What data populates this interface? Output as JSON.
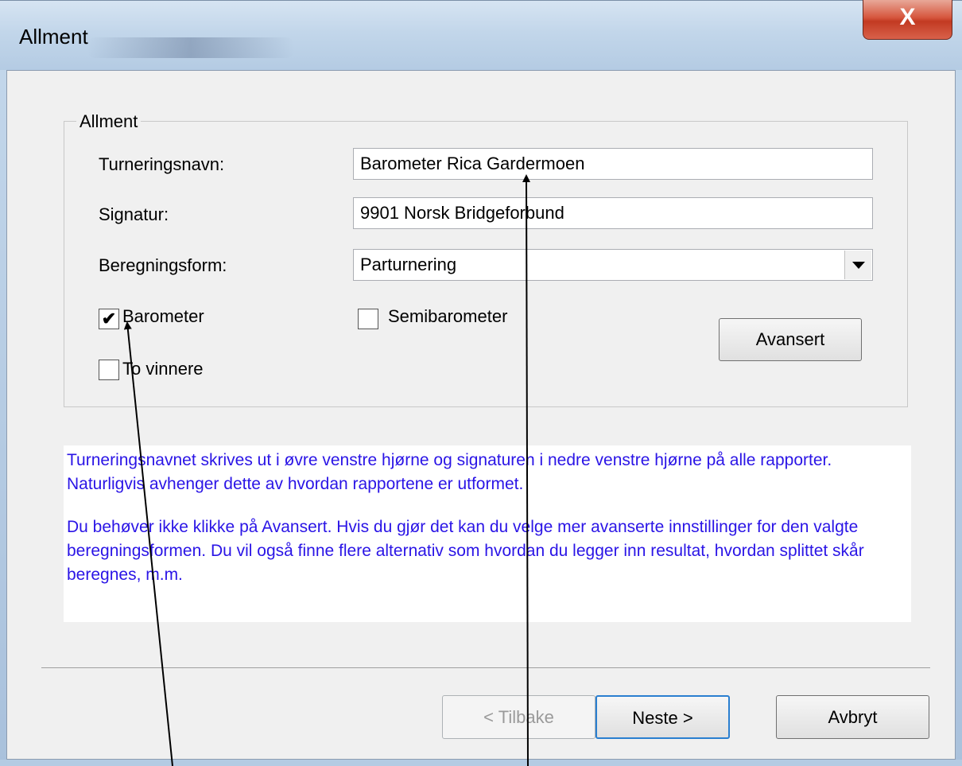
{
  "window": {
    "title": "Allment",
    "close_label": "X"
  },
  "group": {
    "legend": "Allment"
  },
  "form": {
    "tournament_name_label": "Turneringsnavn:",
    "tournament_name_value": "Barometer Rica Gardermoen",
    "signature_label": "Signatur:",
    "signature_value": "9901 Norsk Bridgeforbund",
    "calc_form_label": "Beregningsform:",
    "calc_form_value": "Parturnering",
    "barometer_label": "Barometer",
    "barometer_checked": true,
    "semibarometer_label": "Semibarometer",
    "semibarometer_checked": false,
    "two_winners_label": "To vinnere",
    "two_winners_checked": false,
    "advanced_button": "Avansert"
  },
  "info": {
    "paragraph1": "Turneringsnavnet skrives ut i øvre venstre hjørne og signaturen i nedre venstre hjørne på alle rapporter. Naturligvis avhenger dette av hvordan rapportene er utformet.",
    "paragraph2": "Du behøver ikke klikke på Avansert. Hvis du gjør det kan du velge mer avanserte innstillinger for den valgte beregningsformen. Du vil også finne flere alternativ som hvordan du legger inn resultat, hvordan splittet skår beregnes, m.m."
  },
  "footer": {
    "back_button": "< Tilbake",
    "next_button": "Neste >",
    "cancel_button": "Avbryt"
  },
  "colors": {
    "info_text": "#2a14e6",
    "close_button": "#c23a22"
  }
}
